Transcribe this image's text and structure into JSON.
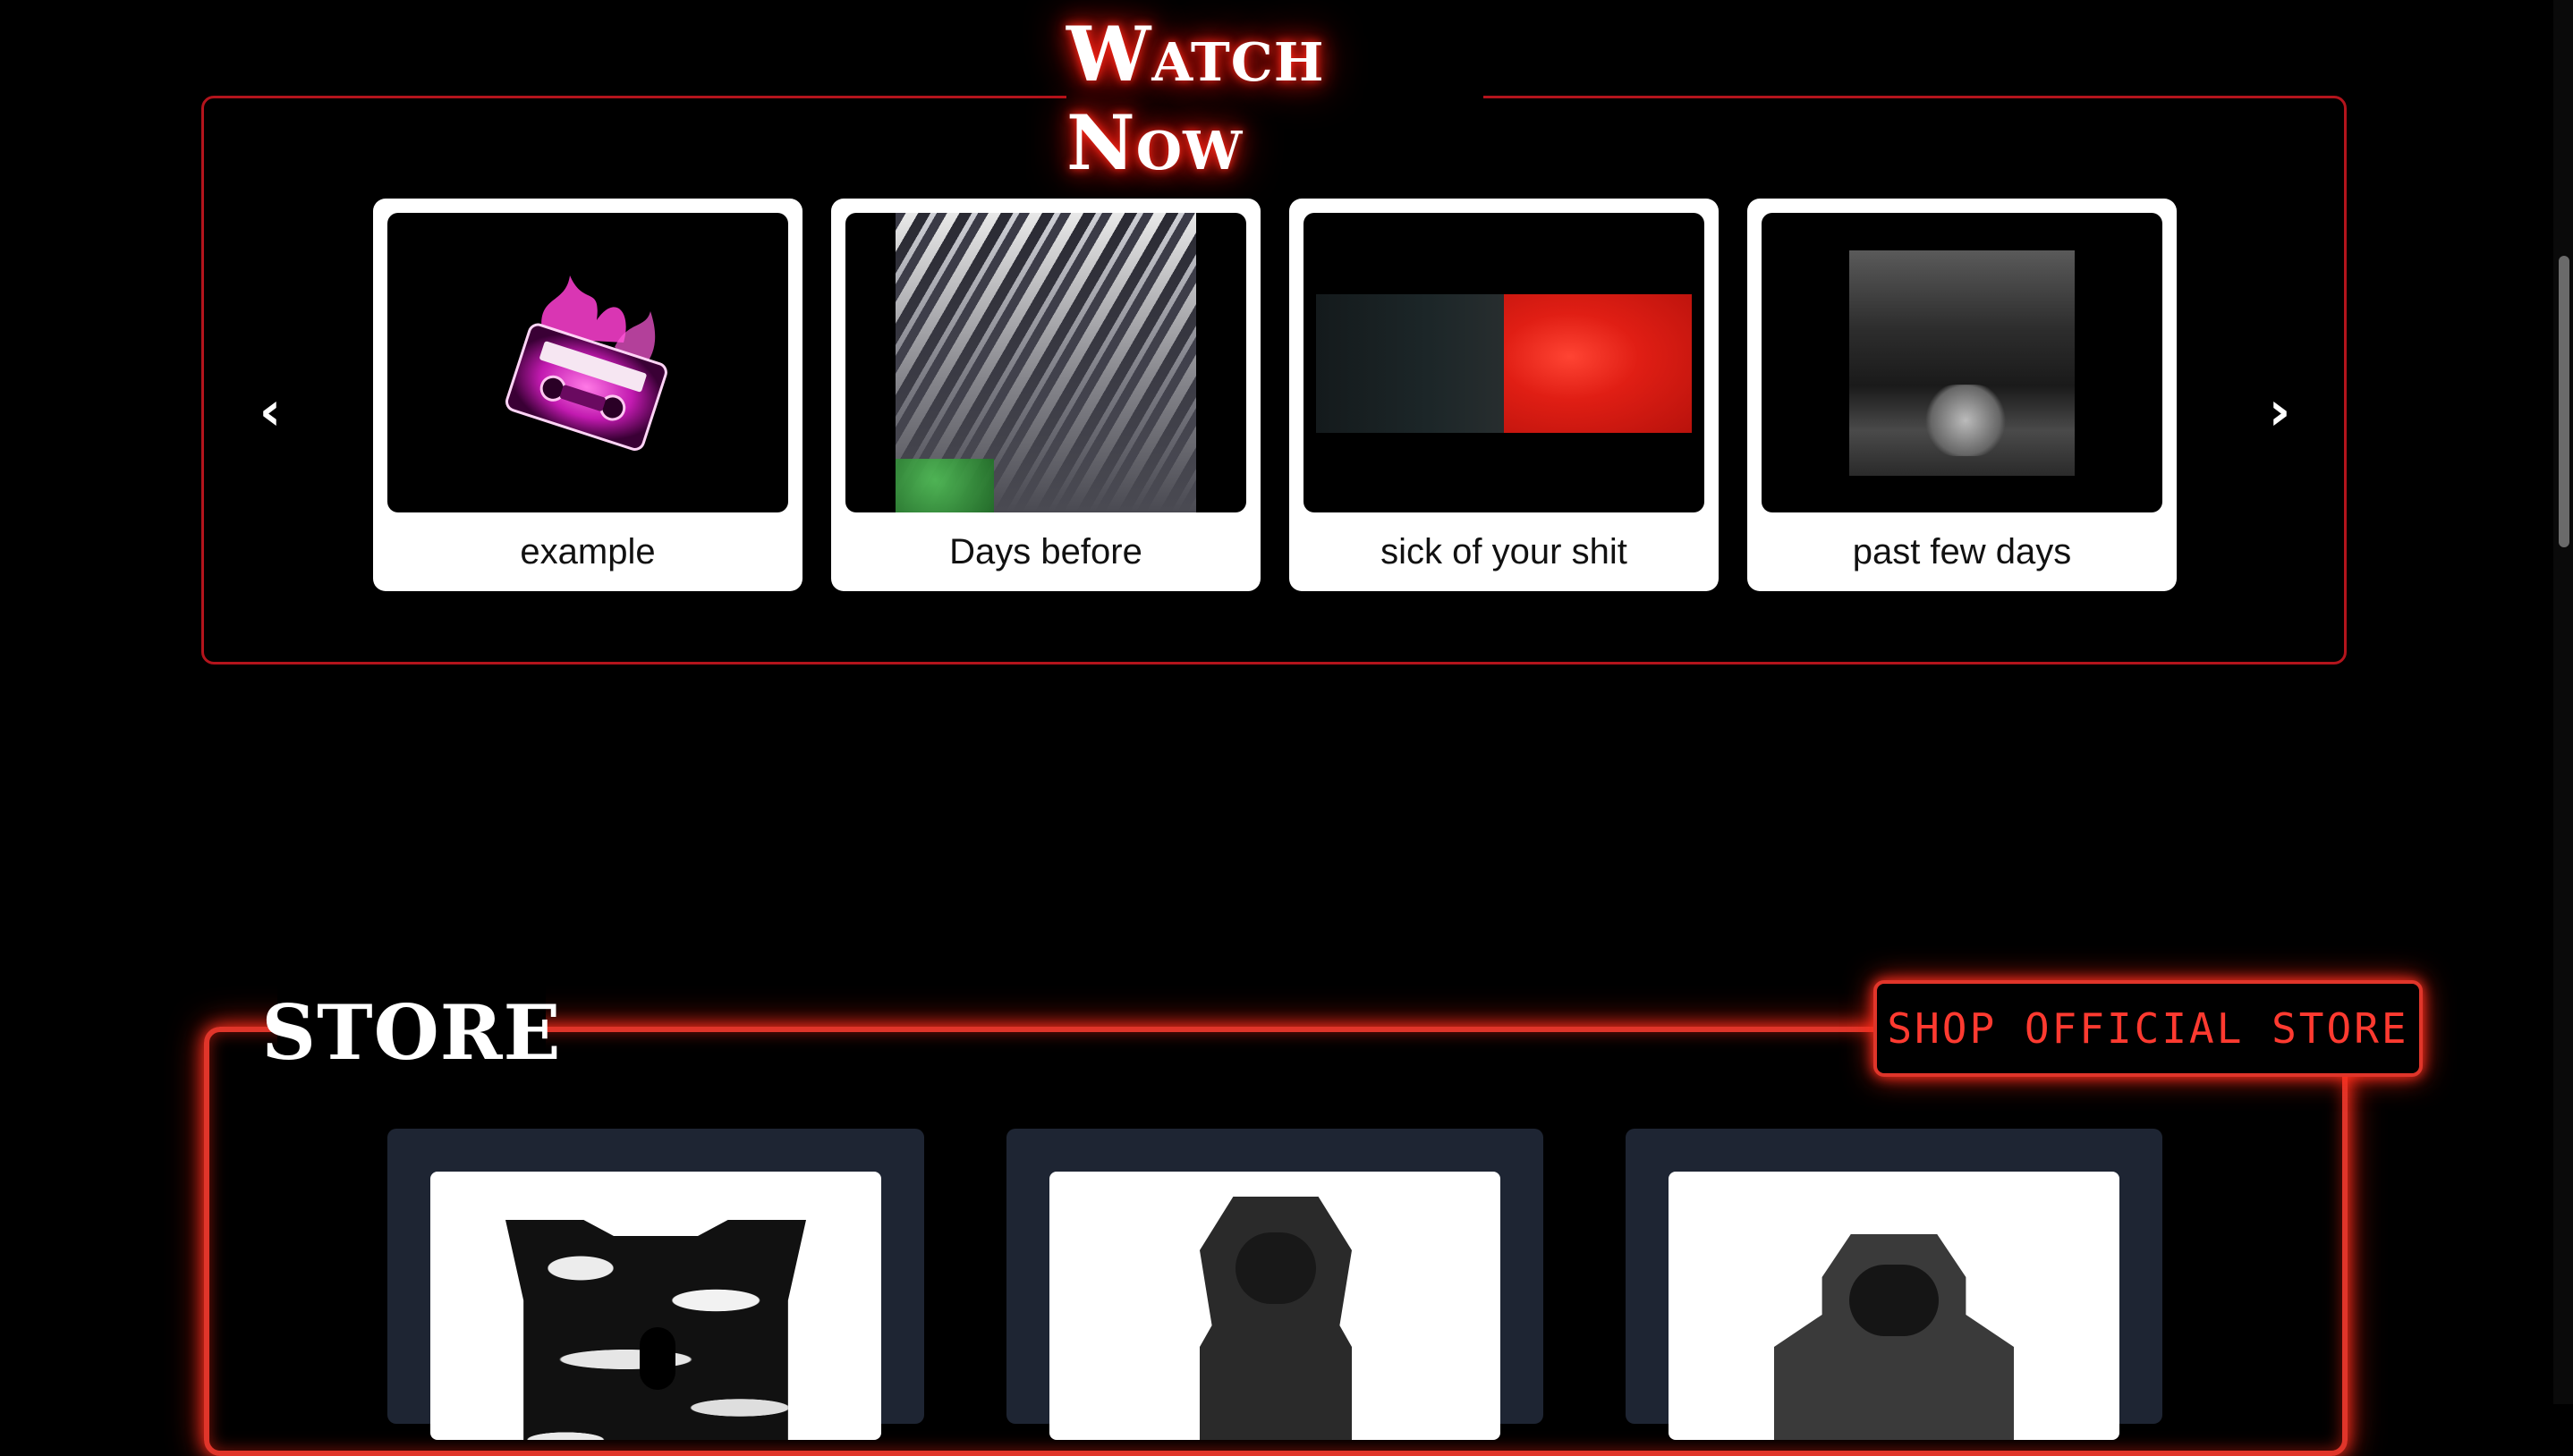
{
  "watch": {
    "title": "Watch Now",
    "prev_label": "‹",
    "next_label": "›",
    "videos": [
      {
        "title": "example"
      },
      {
        "title": "Days before"
      },
      {
        "title": "sick of your shit"
      },
      {
        "title": "past few days"
      }
    ]
  },
  "store": {
    "title": "STORE",
    "shop_button_label": "SHOP OFFICIAL STORE"
  },
  "colors": {
    "background": "#000000",
    "accent_red": "#e0352a",
    "frame_red": "#b3141c",
    "card_white": "#ffffff",
    "product_panel": "#1e2533"
  },
  "icons": {
    "prev": "chevron-left-icon",
    "next": "chevron-right-icon"
  }
}
